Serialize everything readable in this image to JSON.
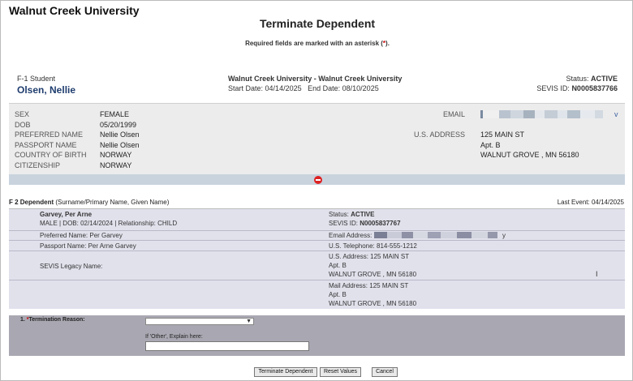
{
  "header": {
    "app_title": "Walnut Creek University",
    "page_title": "Terminate Dependent",
    "required_note_pre": "Required fields are marked with an asterisk (",
    "required_note_ast": "*",
    "required_note_post": ")."
  },
  "student": {
    "type": "F-1 Student",
    "name": "Olsen, Nellie",
    "school": "Walnut Creek University - Walnut Creek University",
    "start_label": "Start Date:",
    "start_date": "04/14/2025",
    "end_label": "End Date:",
    "end_date": "08/10/2025",
    "status_label": "Status:",
    "status": "ACTIVE",
    "sevis_label": "SEVIS ID:",
    "sevis_id": "N0005837766"
  },
  "profile": {
    "sex_label": "SEX",
    "sex": "FEMALE",
    "dob_label": "DOB",
    "dob": "05/20/1999",
    "preferred_label": "PREFERRED NAME",
    "preferred": "Nellie Olsen",
    "passport_label": "PASSPORT NAME",
    "passport": "Nellie Olsen",
    "cob_label": "COUNTRY OF BIRTH",
    "cob": "NORWAY",
    "citizenship_label": "CITIZENSHIP",
    "citizenship": "NORWAY",
    "email_label": "EMAIL",
    "email_tail": "v",
    "address_label": "U.S. ADDRESS",
    "address_line1": "125 MAIN ST",
    "address_line2": "Apt. B",
    "address_line3": "WALNUT GROVE , MN  56180"
  },
  "dependent": {
    "heading_prefix": "F 2 Dependent",
    "heading_suffix": "(Surname/Primary Name, Given Name)",
    "last_event": "Last Event: 04/14/2025",
    "name": "Garvey, Per Arne",
    "summary": "MALE | DOB: 02/14/2024 | Relationship: CHILD",
    "status_label": "Status:",
    "status": "ACTIVE",
    "sevis_label": "SEVIS ID:",
    "sevis_id": "N0005837767",
    "preferred": "Preferred Name: Per Garvey",
    "email_label": "Email Address:",
    "email_tail": "y",
    "passport": "Passport Name: Per Arne Garvey",
    "phone": "U.S. Telephone: 814-555-1212",
    "legacy": "SEVIS Legacy Name:",
    "us_address_line1": "U.S. Address: 125 MAIN ST",
    "us_address_line2": "Apt. B",
    "us_address_line3": "WALNUT GROVE , MN  56180",
    "mail_address_line1": "Mail Address:  125 MAIN ST",
    "mail_address_line2": "Apt. B",
    "mail_address_line3": "WALNUT GROVE , MN  56180"
  },
  "form": {
    "reason_number": "1.",
    "reason_ast": "*",
    "reason_label": "Termination Reason:",
    "reason_value": "",
    "explain_label": "If 'Other', Explain here:",
    "explain_value": ""
  },
  "buttons": {
    "terminate": "Terminate Dependent",
    "reset": "Reset Values",
    "cancel": "Cancel"
  },
  "colors": {
    "name_blue": "#1f3d6e",
    "collapse_red": "#dd2222",
    "form_bg": "#a9a8b2"
  }
}
